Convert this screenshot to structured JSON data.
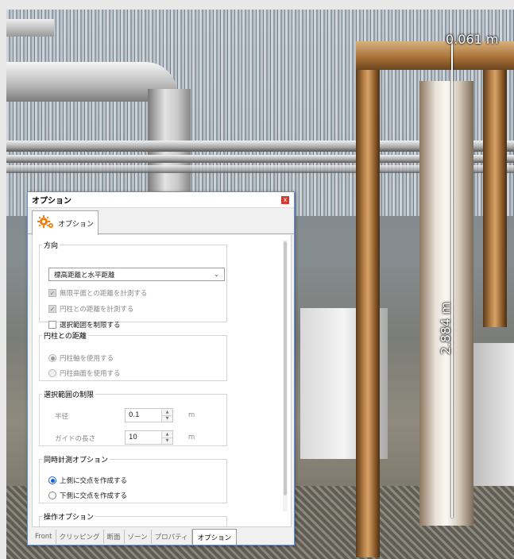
{
  "viewport": {
    "measurement_top": "0.061 m",
    "measurement_side": "2.884 m"
  },
  "dialog": {
    "title": "オプション",
    "close_glyph": "x",
    "tab_label": "オプション",
    "tab_icon": "gear-icon"
  },
  "direction_group": {
    "legend": "方向",
    "select_value": "標高距離と水平距離",
    "chk_infinite_plane": "無限平面との距離を計測する",
    "chk_cylinder": "円柱との距離を計測する",
    "chk_limit_range": "選択範囲を制限する"
  },
  "cylinder_group": {
    "legend": "円柱との距離",
    "radio_axis": "円柱軸を使用する",
    "radio_surface": "円柱曲面を使用する"
  },
  "range_group": {
    "legend": "選択範囲の制限",
    "radius_label": "半径",
    "radius_value": "0.1",
    "radius_unit": "m",
    "guide_label": "ガイドの長さ",
    "guide_value": "10",
    "guide_unit": "m"
  },
  "simul_group": {
    "legend": "同時計測オプション",
    "radio_upper": "上側に交点を作成する",
    "radio_lower": "下側に交点を作成する"
  },
  "operation_group": {
    "legend": "操作オプション"
  },
  "bottom_tabs": [
    "Front",
    "クリッピング",
    "断面",
    "ゾーン",
    "プロパティ",
    "オプション"
  ],
  "colors": {
    "title_close": "#d43a2f",
    "radio_selected": "#1a5fcf",
    "gear_orange": "#f07d10"
  }
}
